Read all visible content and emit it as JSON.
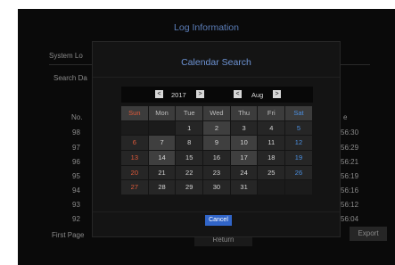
{
  "background": {
    "title": "Log Information",
    "tab_label": "System Lo",
    "search_label": "Search Da",
    "column_no": "No.",
    "column_time": "e",
    "rows": [
      {
        "no": "98",
        "time": "56:30"
      },
      {
        "no": "97",
        "time": "56:29"
      },
      {
        "no": "96",
        "time": "56:21"
      },
      {
        "no": "95",
        "time": "56:19"
      },
      {
        "no": "94",
        "time": "56:16"
      },
      {
        "no": "93",
        "time": "56:12"
      },
      {
        "no": "92",
        "time": "56:04"
      }
    ],
    "first_page": "First Page",
    "export": "Export",
    "return": "Return"
  },
  "modal": {
    "title": "Calendar Search",
    "year": "2017",
    "month": "Aug",
    "prev_glyph": "<",
    "next_glyph": ">",
    "weekdays": [
      "Sun",
      "Mon",
      "Tue",
      "Wed",
      "Thu",
      "Fri",
      "Sat"
    ],
    "weeks": [
      [
        "",
        "",
        "1",
        "2",
        "3",
        "4",
        "5"
      ],
      [
        "6",
        "7",
        "8",
        "9",
        "10",
        "11",
        "12"
      ],
      [
        "13",
        "14",
        "15",
        "16",
        "17",
        "18",
        "19"
      ],
      [
        "20",
        "21",
        "22",
        "23",
        "24",
        "25",
        "26"
      ],
      [
        "27",
        "28",
        "29",
        "30",
        "31",
        "",
        ""
      ]
    ],
    "recorded_days": [
      "2",
      "7",
      "9",
      "10",
      "14",
      "17"
    ],
    "cancel": "Cancel"
  },
  "colors": {
    "accent": "#3165c8",
    "title": "#6d93d4",
    "sunday": "#e05a3a",
    "saturday": "#4b8fe0"
  }
}
